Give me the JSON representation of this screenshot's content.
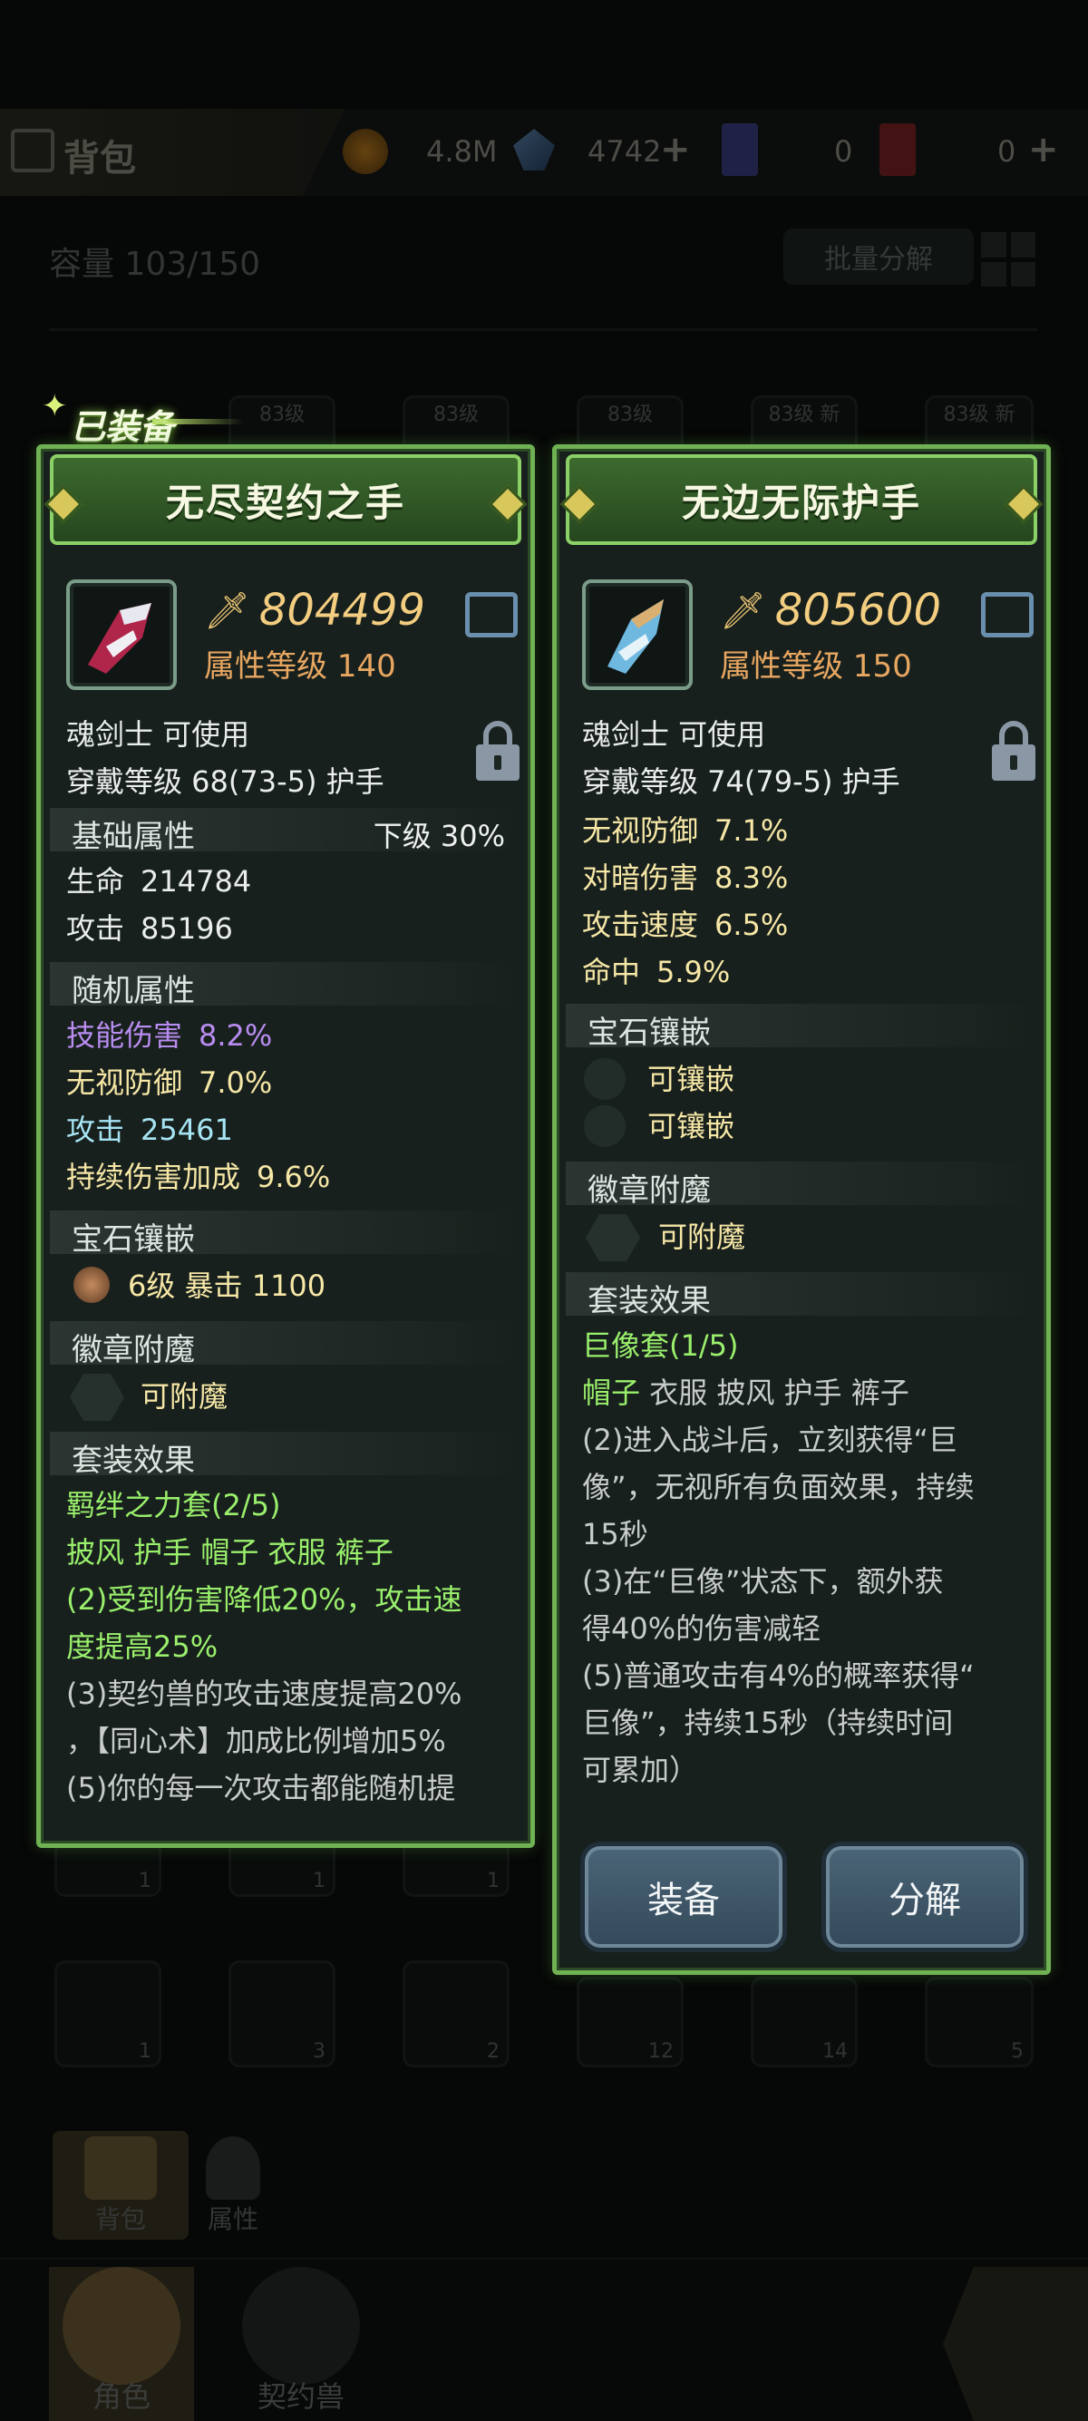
{
  "topbar": {
    "title": "背包",
    "gold": "4.8M",
    "crystal": "4742",
    "ticket1": "0",
    "ticket2": "0"
  },
  "inventory": {
    "capacity": "容量 103/150",
    "batch_label": "批量分解",
    "slot_level_tags": [
      "83级",
      "83级",
      "83级",
      "83级 新",
      "83级 新"
    ],
    "row1_counts": [
      "1",
      "1",
      "1"
    ],
    "row2_counts": [
      "1",
      "3",
      "2",
      "12",
      "14",
      "5"
    ]
  },
  "equipped_tag": "已装备",
  "left_item": {
    "name": "无尽契约之手",
    "power": "804499",
    "attr_level": "属性等级 140",
    "class_req": "魂剑士 可使用",
    "wear_level": "穿戴等级 68(73-5)  护手",
    "base_section": "基础属性",
    "base_grade": "下级  30%",
    "base_stats": [
      {
        "name": "生命",
        "value": "214784"
      },
      {
        "name": "攻击",
        "value": "85196"
      }
    ],
    "random_section": "随机属性",
    "random_stats": [
      {
        "name": "技能伤害",
        "value": "8.2%"
      },
      {
        "name": "无视防御",
        "value": "7.0%"
      },
      {
        "name": "攻击",
        "value": "25461"
      },
      {
        "name": "持续伤害加成",
        "value": "9.6%"
      }
    ],
    "gem_section": "宝石镶嵌",
    "gem_line": "6级   暴击 1100",
    "badge_section": "徽章附魔",
    "badge_line": "可附魔",
    "set_section": "套装效果",
    "set_name": "羁绊之力套(2/5)",
    "set_parts": "披风 护手 帽子 衣服 裤子",
    "set_effects": [
      "(2)受到伤害降低20%，攻击速",
      "度提高25%",
      "(3)契约兽的攻击速度提高20%",
      "，【同心术】加成比例增加5%",
      "(5)你的每一次攻击都能随机提"
    ]
  },
  "right_item": {
    "name": "无边无际护手",
    "power": "805600",
    "attr_level": "属性等级 150",
    "class_req": "魂剑士 可使用",
    "wear_level": "穿戴等级 74(79-5)  护手",
    "stats": [
      {
        "name": "无视防御",
        "value": "7.1%"
      },
      {
        "name": "对暗伤害",
        "value": "8.3%"
      },
      {
        "name": "攻击速度",
        "value": "6.5%"
      },
      {
        "name": "命中",
        "value": "5.9%"
      }
    ],
    "gem_section": "宝石镶嵌",
    "gem_slots": [
      "可镶嵌",
      "可镶嵌"
    ],
    "badge_section": "徽章附魔",
    "badge_line": "可附魔",
    "set_section": "套装效果",
    "set_name": "巨像套(1/5)",
    "set_part_active": "帽子",
    "set_parts_rest": " 衣服 披风 护手 裤子",
    "set_effects": [
      "(2)进入战斗后，立刻获得“巨",
      "像”，无视所有负面效果，持续",
      "15秒",
      "(3)在“巨像”状态下，额外获",
      "得40%的伤害减轻",
      "(5)普通攻击有4%的概率获得“",
      "巨像”，持续15秒（持续时间",
      "可累加）"
    ],
    "equip_label": "装备",
    "decompose_label": "分解"
  },
  "bottom_tabs": {
    "bag": "背包",
    "attributes": "属性"
  },
  "nav": {
    "character": "角色",
    "pet": "契约兽"
  }
}
